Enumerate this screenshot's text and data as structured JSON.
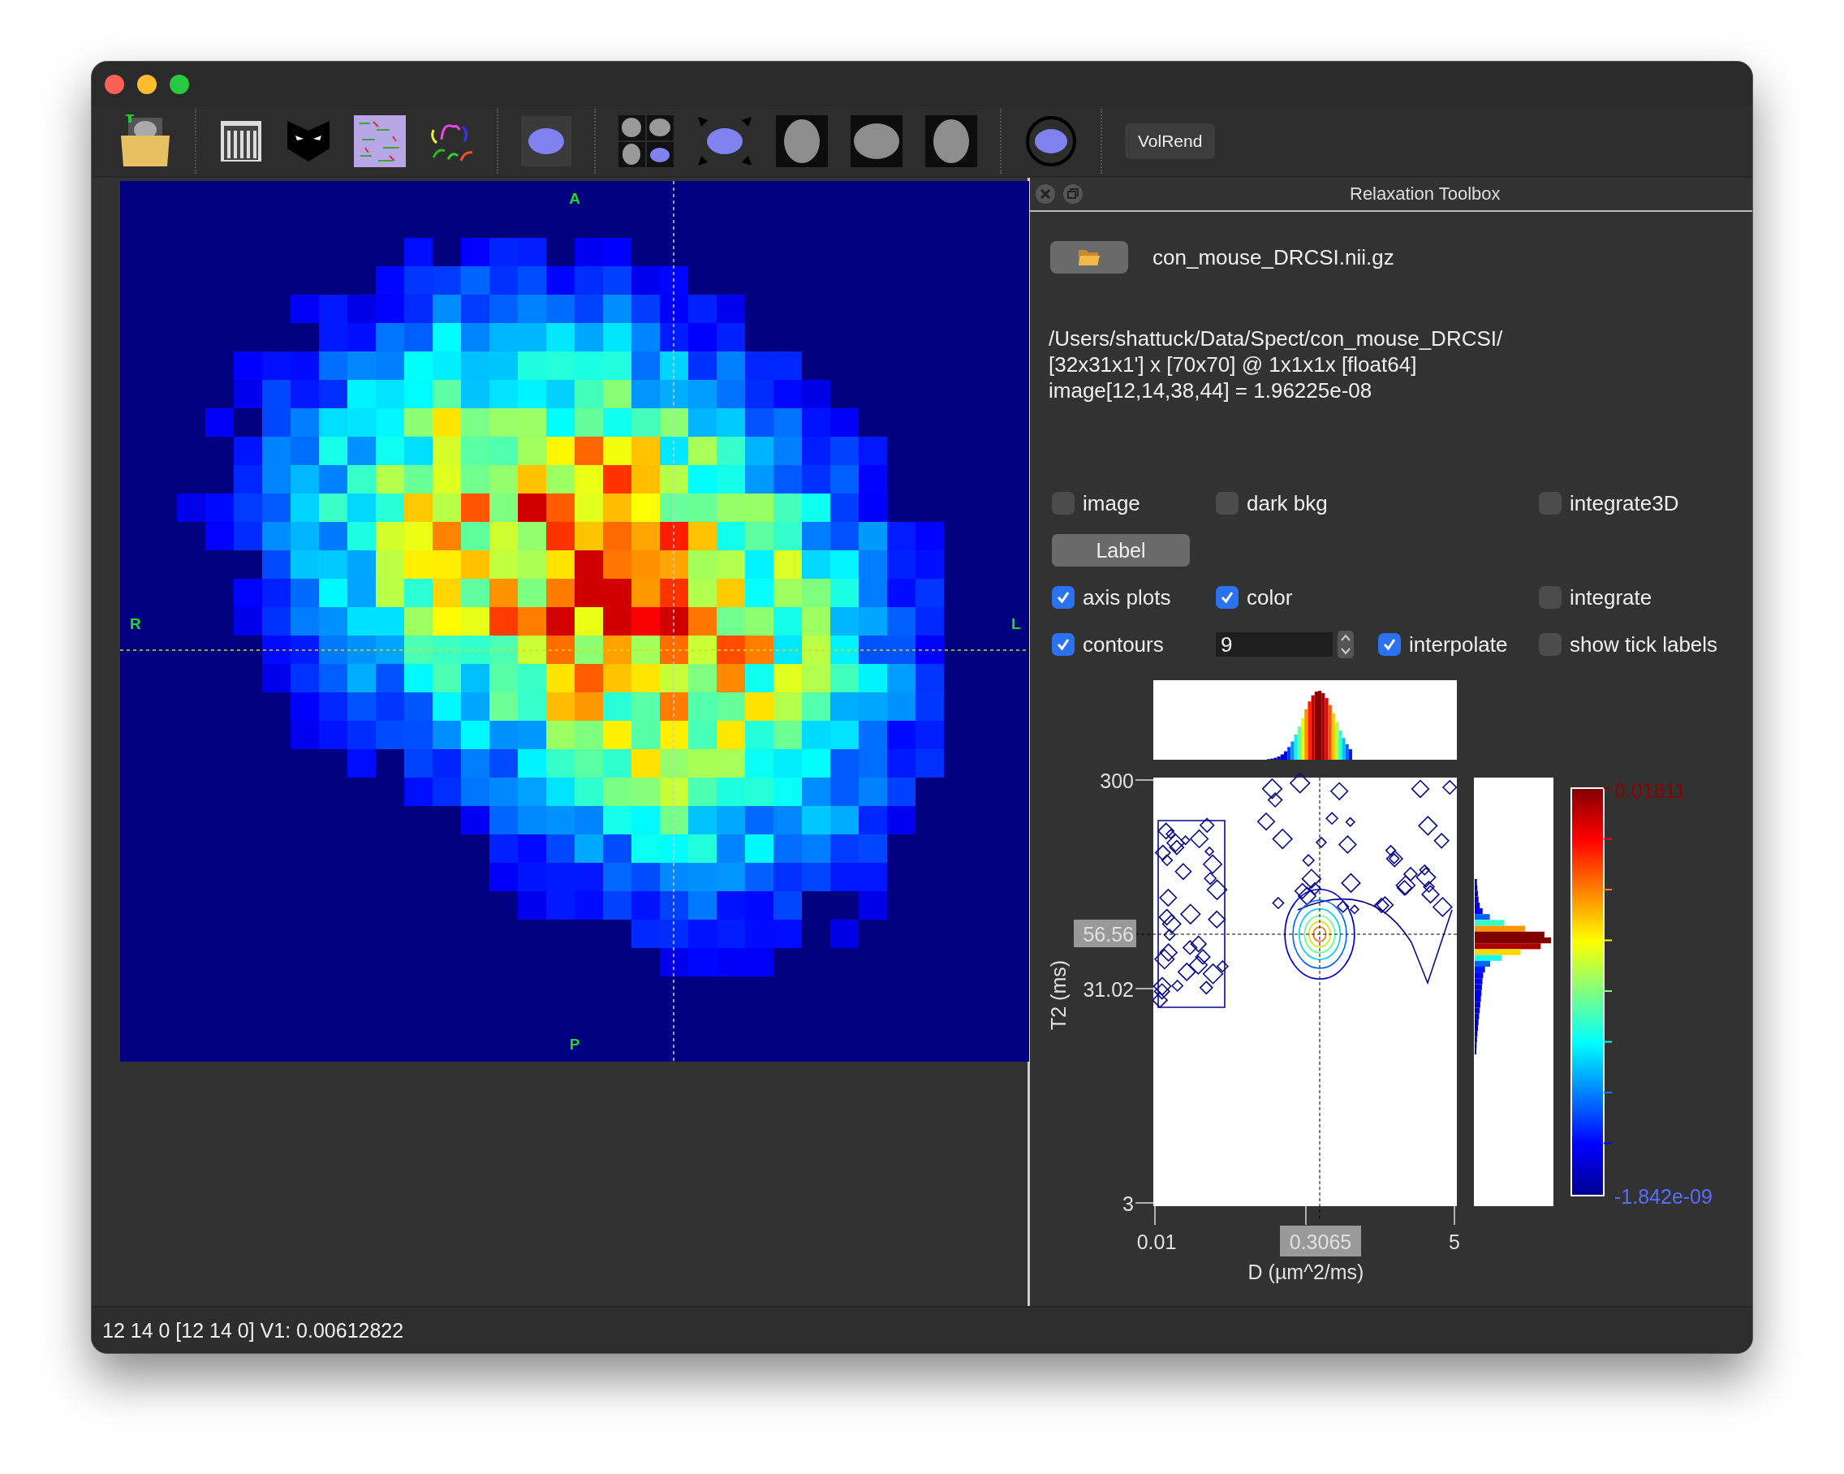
{
  "toolbar": {
    "volrend_button": "VolRend"
  },
  "image_view": {
    "top_label": "A",
    "bottom_label": "P",
    "left_label": "R",
    "right_label": "L"
  },
  "toolbox": {
    "title": "Relaxation Toolbox",
    "file_name": "con_mouse_DRCSI.nii.gz",
    "info_lines": [
      "/Users/shattuck/Data/Spect/con_mouse_DRCSI/",
      "[32x31x1'] x [70x70] @ 1x1x1x [float64]",
      "image[12,14,38,44] = 1.96225e-08"
    ],
    "control_rows": [
      [
        {
          "kind": "checkbox",
          "label": "image",
          "checked": false
        },
        {
          "kind": "checkbox",
          "label": "dark bkg",
          "checked": false
        },
        {
          "kind": "checkbox",
          "label": "integrate3D",
          "checked": false
        }
      ],
      [
        {
          "kind": "button",
          "label": "Label"
        }
      ],
      [
        {
          "kind": "checkbox",
          "label": "axis plots",
          "checked": true
        },
        {
          "kind": "checkbox",
          "label": "color",
          "checked": true
        },
        {
          "kind": "checkbox",
          "label": "integrate",
          "checked": false
        }
      ],
      [
        {
          "kind": "checkbox",
          "label": "contours",
          "checked": true
        },
        {
          "kind": "spinbox",
          "value": "9"
        },
        {
          "kind": "checkbox",
          "label": "interpolate",
          "checked": true
        },
        {
          "kind": "checkbox",
          "label": "show tick labels",
          "checked": false
        }
      ]
    ]
  },
  "plot": {
    "y_ticks": [
      "300",
      "31.02",
      "3"
    ],
    "y_cursor": "56.56",
    "x_ticks": [
      "0.01",
      "5"
    ],
    "x_cursor": "0.3065",
    "xlabel": "D (µm^2/ms)",
    "ylabel": "T2 (ms)",
    "colorbar_max": "0.01811",
    "colorbar_min": "-1.842e-09"
  },
  "status_bar": "12 14 0 [12 14 0] V1: 0.00612822"
}
